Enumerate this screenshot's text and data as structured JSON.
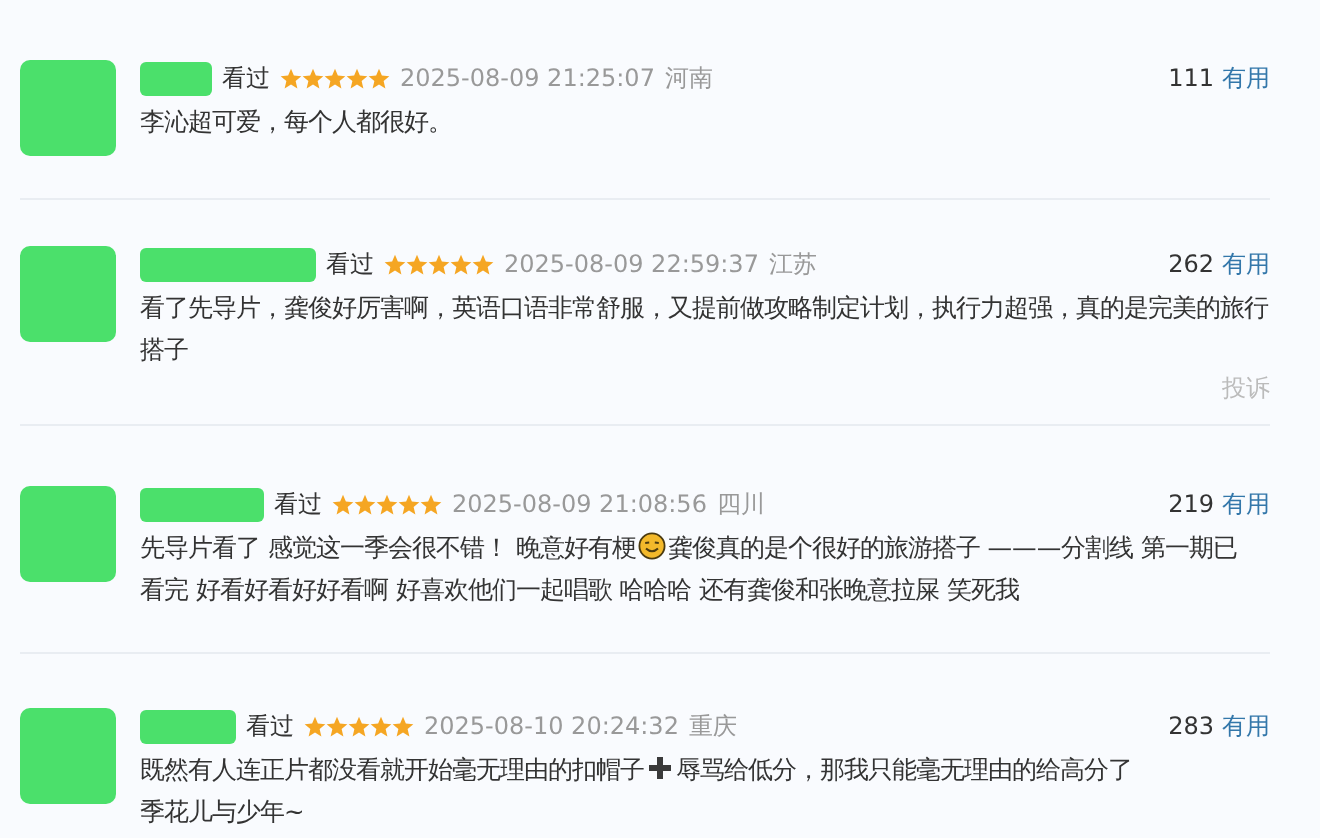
{
  "comments": [
    {
      "status": "看过",
      "stars": 5,
      "time": "2025-08-09 21:25:07",
      "region": "河南",
      "votes": "111",
      "useful": "有用",
      "segments": [
        {
          "kind": "text",
          "text": "李沁超可爱，每个人都很好。"
        }
      ]
    },
    {
      "status": "看过",
      "stars": 5,
      "time": "2025-08-09 22:59:37",
      "region": "江苏",
      "votes": "262",
      "useful": "有用",
      "segments": [
        {
          "kind": "text",
          "text": "看了先导片，龚俊好厉害啊，英语口语非常舒服，又提前做攻略制定计划，执行力超强，真的是完美的旅行搭子"
        }
      ],
      "report": "投诉"
    },
    {
      "status": "看过",
      "stars": 5,
      "time": "2025-08-09 21:08:56",
      "region": "四川",
      "votes": "219",
      "useful": "有用",
      "segments": [
        {
          "kind": "text",
          "text": "先导片看了 感觉这一季会很不错！ 晚意好有梗"
        },
        {
          "kind": "smiley"
        },
        {
          "kind": "text",
          "text": "龚俊真的是个很好的旅游搭子 ———分割线 第一期已"
        },
        {
          "kind": "text",
          "text": "看完 好看好看好好看啊 好喜欢他们一起唱歌 哈哈哈 还有龚俊和张晚意拉屎 笑死我"
        }
      ]
    },
    {
      "status": "看过",
      "stars": 5,
      "time": "2025-08-10 20:24:32",
      "region": "重庆",
      "votes": "283",
      "useful": "有用",
      "segments": [
        {
          "kind": "text",
          "text": "既然有人连正片都没看就开始毫无理由的扣帽子"
        },
        {
          "kind": "plus"
        },
        {
          "kind": "text",
          "text": "辱骂给低分，那我只能毫无理由的给高分了"
        },
        {
          "kind": "text",
          "text": "季花儿与少年~"
        }
      ]
    }
  ]
}
